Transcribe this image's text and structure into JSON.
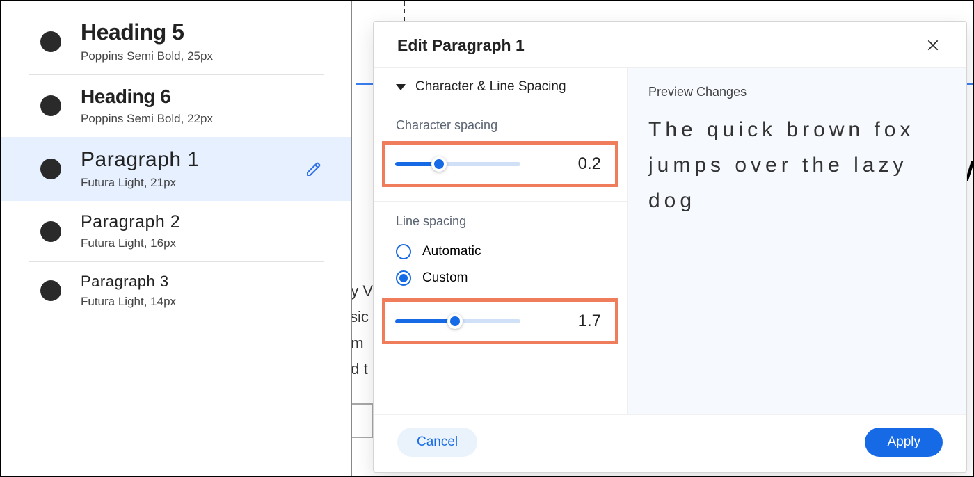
{
  "styles": [
    {
      "name": "Heading 5",
      "meta": "Poppins Semi Bold, 25px",
      "class": "h5",
      "selected": false
    },
    {
      "name": "Heading 6",
      "meta": "Poppins Semi Bold, 22px",
      "class": "h6",
      "selected": false
    },
    {
      "name": "Paragraph 1",
      "meta": "Futura Light, 21px",
      "class": "p1",
      "selected": true
    },
    {
      "name": "Paragraph 2",
      "meta": "Futura Light, 16px",
      "class": "p2",
      "selected": false
    },
    {
      "name": "Paragraph 3",
      "meta": "Futura Light, 14px",
      "class": "p3",
      "selected": false
    }
  ],
  "bg_text_lines": [
    "by V",
    "ssic",
    "um",
    "ad t"
  ],
  "bg_big_letter": "M",
  "dialog": {
    "title": "Edit Paragraph 1",
    "section": "Character & Line Spacing",
    "char_label": "Character spacing",
    "char_value": "0.2",
    "char_fill_pct": 35,
    "line_label": "Line spacing",
    "line_value": "1.7",
    "line_fill_pct": 48,
    "radio_auto": "Automatic",
    "radio_custom": "Custom",
    "radio_selected": "custom",
    "preview_label": "Preview Changes",
    "preview_text": "The quick brown fox jumps over the lazy dog",
    "cancel": "Cancel",
    "apply": "Apply"
  }
}
